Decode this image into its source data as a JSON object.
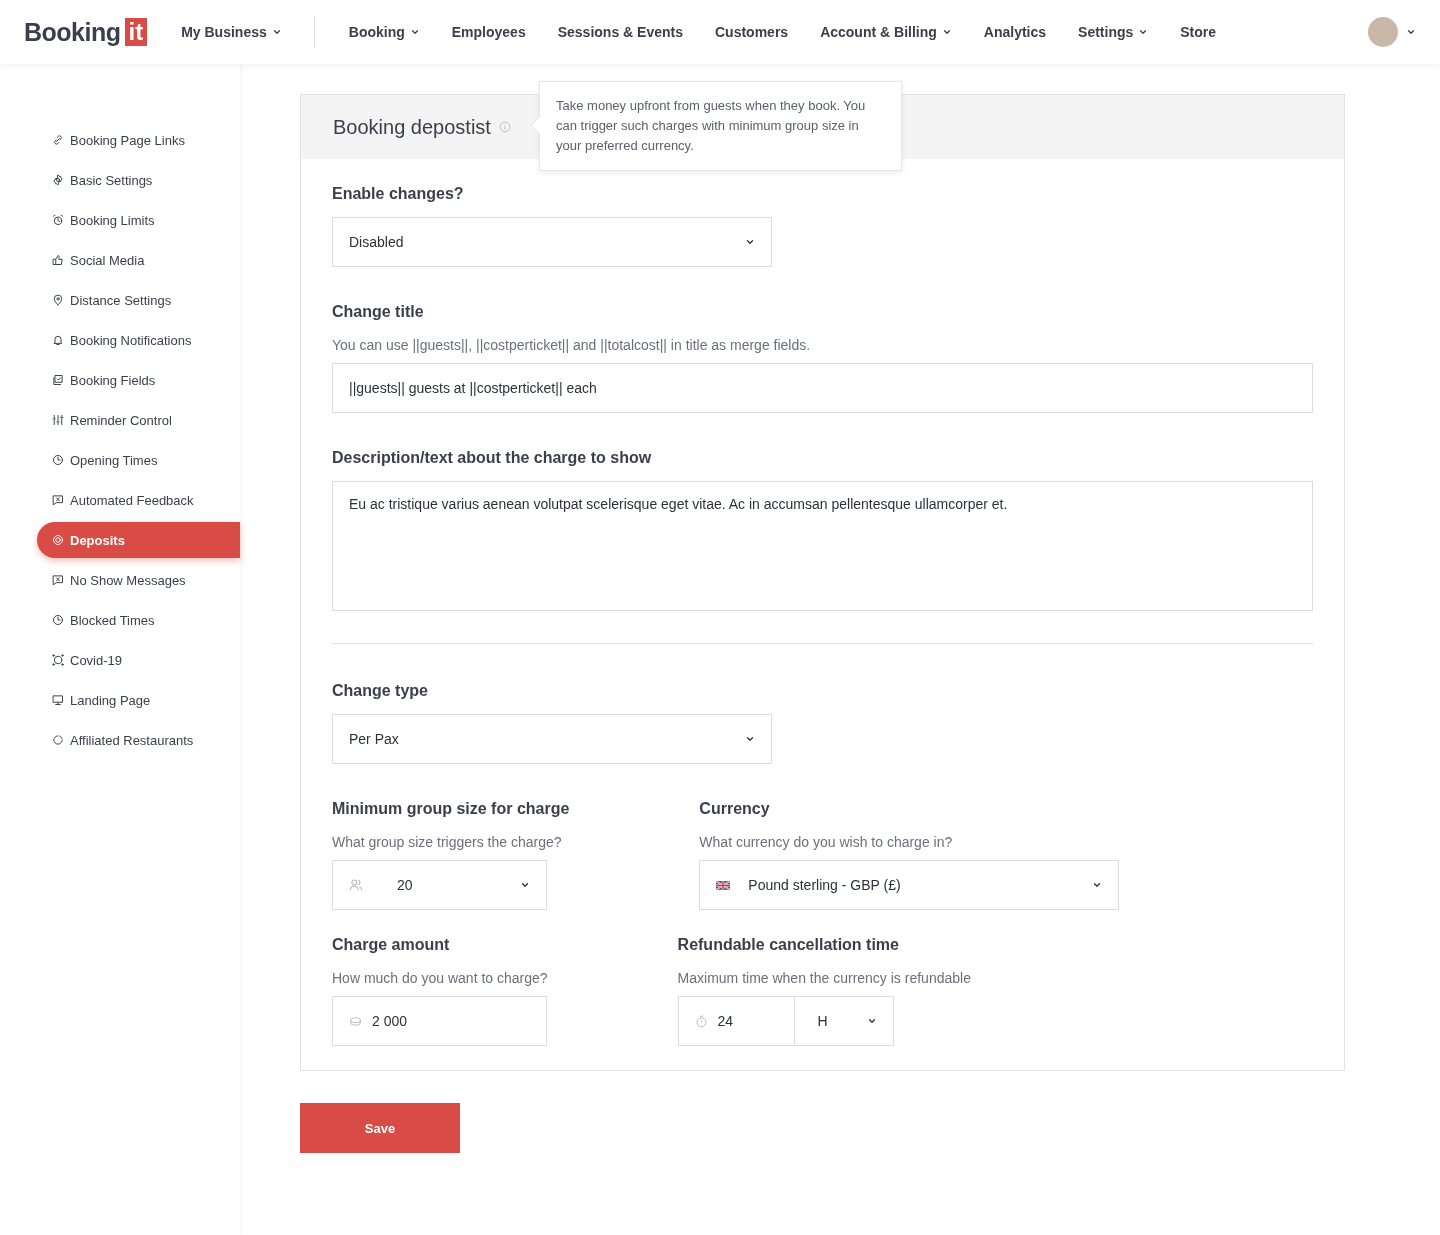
{
  "header": {
    "logo": {
      "word": "Booking",
      "badge": "it"
    },
    "nav": [
      {
        "label": "My Business",
        "dropdown": true
      },
      {
        "label": "Booking",
        "dropdown": true
      },
      {
        "label": "Employees",
        "dropdown": false
      },
      {
        "label": "Sessions & Events",
        "dropdown": false
      },
      {
        "label": "Customers",
        "dropdown": false
      },
      {
        "label": "Account & Billing",
        "dropdown": true
      },
      {
        "label": "Analytics",
        "dropdown": false
      },
      {
        "label": "Settings",
        "dropdown": true
      },
      {
        "label": "Store",
        "dropdown": false
      }
    ]
  },
  "sidebar": {
    "items": [
      {
        "label": "Booking Page Links",
        "selected": false
      },
      {
        "label": "Basic Settings",
        "selected": false
      },
      {
        "label": "Booking Limits",
        "selected": false
      },
      {
        "label": "Social Media",
        "selected": false
      },
      {
        "label": "Distance Settings",
        "selected": false
      },
      {
        "label": "Booking Notifications",
        "selected": false
      },
      {
        "label": "Booking Fields",
        "selected": false
      },
      {
        "label": "Reminder Control",
        "selected": false
      },
      {
        "label": "Opening Times",
        "selected": false
      },
      {
        "label": "Automated Feedback",
        "selected": false
      },
      {
        "label": "Deposits",
        "selected": true
      },
      {
        "label": "No Show Messages",
        "selected": false
      },
      {
        "label": "Blocked Times",
        "selected": false
      },
      {
        "label": "Covid-19",
        "selected": false
      },
      {
        "label": "Landing Page",
        "selected": false
      },
      {
        "label": "Affiliated Restaurants",
        "selected": false
      }
    ]
  },
  "card": {
    "title": "Booking depostist",
    "tooltip": "Take money upfront from guests when they book. You can trigger such charges with minimum group size in your preferred currency.",
    "enable": {
      "label": "Enable changes?",
      "value": "Disabled"
    },
    "change_title": {
      "label": "Change title",
      "hint": "You can use ||guests||, ||costperticket|| and ||totalcost|| in title as merge fields.",
      "value": "||guests|| guests at ||costperticket|| each"
    },
    "description": {
      "label": "Description/text about the charge to show",
      "value": "Eu ac tristique varius aenean volutpat scelerisque eget vitae. Ac in accumsan pellentesque ullamcorper et."
    },
    "change_type": {
      "label": "Change type",
      "value": "Per Pax"
    },
    "min_group": {
      "label": "Minimum group size for charge",
      "hint": "What group size triggers the charge?",
      "value": "20"
    },
    "currency": {
      "label": "Currency",
      "hint": "What currency do you wish to charge in?",
      "value": "Pound sterling - GBP (£)"
    },
    "charge_amount": {
      "label": "Charge amount",
      "hint": "How much do you want to charge?",
      "value": "2 000"
    },
    "refund": {
      "label": "Refundable cancellation time",
      "hint": "Maximum time when the currency is refundable",
      "value": "24",
      "unit": "H"
    }
  },
  "save_button": "Save"
}
